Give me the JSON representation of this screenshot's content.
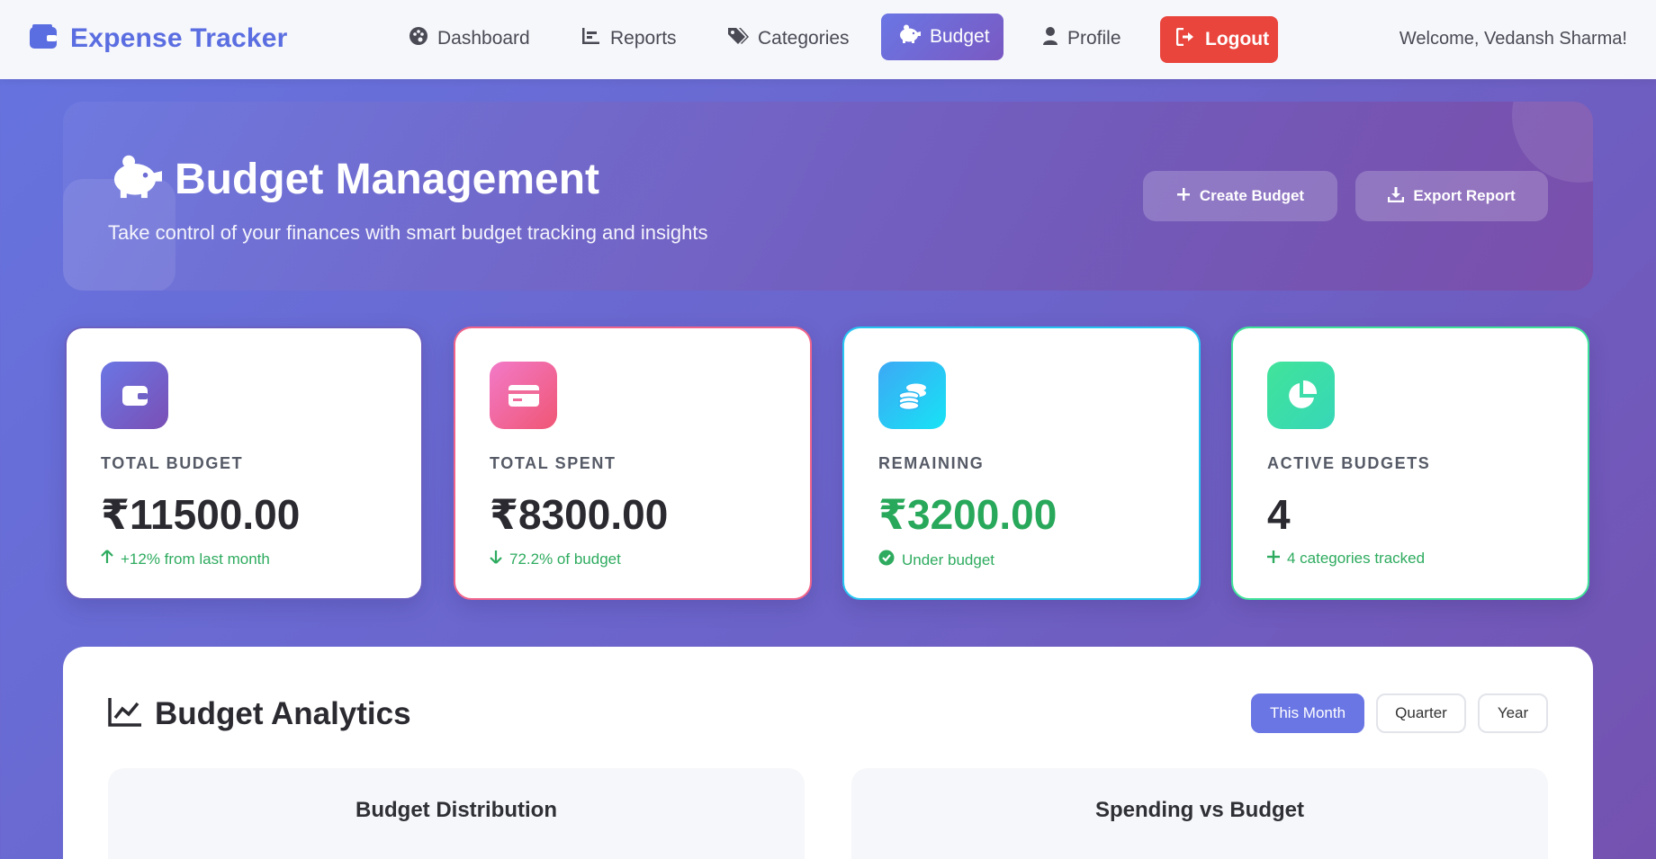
{
  "nav": {
    "brand": "Expense Tracker",
    "items": [
      {
        "label": "Dashboard",
        "icon": "palette-icon"
      },
      {
        "label": "Reports",
        "icon": "chart-bar-icon"
      },
      {
        "label": "Categories",
        "icon": "tags-icon"
      },
      {
        "label": "Budget",
        "icon": "piggy-bank-icon",
        "active": true
      },
      {
        "label": "Profile",
        "icon": "user-icon"
      }
    ],
    "logout": "Logout",
    "welcome": "Welcome, Vedansh Sharma!"
  },
  "hero": {
    "title": "Budget Management",
    "subtitle": "Take control of your finances with smart budget tracking and insights",
    "create_button": "Create Budget",
    "export_button": "Export Report"
  },
  "stats": [
    {
      "label": "TOTAL BUDGET",
      "value": "₹11500.00",
      "note": "+12% from last month",
      "note_icon": "arrow-up-icon",
      "accent": "#6a5fc0"
    },
    {
      "label": "TOTAL SPENT",
      "value": "₹8300.00",
      "note": "72.2% of budget",
      "note_icon": "arrow-down-icon",
      "accent": "#f0648b"
    },
    {
      "label": "REMAINING",
      "value": "₹3200.00",
      "note": "Under budget",
      "note_icon": "check-circle-icon",
      "accent": "#27c6f2"
    },
    {
      "label": "ACTIVE BUDGETS",
      "value": "4",
      "note": "4 categories tracked",
      "note_icon": "plus-icon",
      "accent": "#3fe39a"
    }
  ],
  "analytics": {
    "title": "Budget Analytics",
    "periods": [
      "This Month",
      "Quarter",
      "Year"
    ],
    "selected_period": "This Month",
    "charts": [
      "Budget Distribution",
      "Spending vs Budget"
    ]
  },
  "colors": {
    "brand": "#5b6ee1",
    "active_nav": "#6a76e4",
    "logout": "#e9453d",
    "positive": "#2eab5f"
  }
}
